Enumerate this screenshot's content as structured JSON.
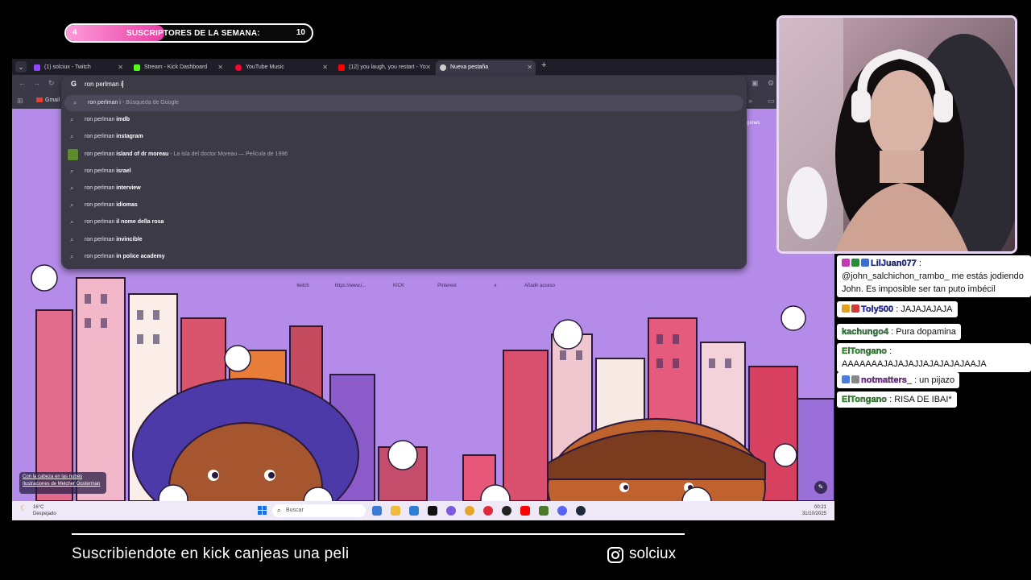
{
  "sub_goal": {
    "current": "4",
    "label": "SUSCRIPTORES DE LA SEMANA:",
    "goal": "10",
    "progress_fraction": 0.4,
    "fill_color": "#ff5fc4"
  },
  "browser": {
    "tabs": [
      {
        "label": "(1) solciux - Twitch",
        "icon": "twitch-icon",
        "color": "#9146ff"
      },
      {
        "label": "Stream - Kick Dashboard",
        "icon": "kick-icon",
        "color": "#53fc18"
      },
      {
        "label": "YouTube Music",
        "icon": "youtube-music-icon",
        "color": "#ff0033"
      },
      {
        "label": "(12) you laugh, you restart - Yo",
        "icon": "youtube-icon",
        "color": "#ff0000"
      },
      {
        "label": "Nueva pestaña",
        "icon": "chrome-icon",
        "color": "#cccccc"
      }
    ],
    "new_tab": "+",
    "bookmark_gmail": "Gmail",
    "omnibox": {
      "query": "ron perlman i",
      "suggestions": [
        {
          "prefix": "ron perlman i",
          "bold": "",
          "desc": " - Búsqueda de Google",
          "selected": true
        },
        {
          "prefix": "ron perlman ",
          "bold": "imdb",
          "desc": ""
        },
        {
          "prefix": "ron perlman ",
          "bold": "instagram",
          "desc": ""
        },
        {
          "prefix": "ron perlman ",
          "bold": "island of dr moreau",
          "desc": " - La isla del doctor Moreau — Película de 1996",
          "thumb": true
        },
        {
          "prefix": "ron perlman ",
          "bold": "israel",
          "desc": ""
        },
        {
          "prefix": "ron perlman ",
          "bold": "interview",
          "desc": ""
        },
        {
          "prefix": "ron perlman ",
          "bold": "idiomas",
          "desc": ""
        },
        {
          "prefix": "ron perlman ",
          "bold": "il nome della rosa",
          "desc": ""
        },
        {
          "prefix": "ron perlman ",
          "bold": "invincible",
          "desc": ""
        },
        {
          "prefix": "ron perlman ",
          "bold": "in police academy",
          "desc": ""
        }
      ]
    },
    "shortcuts": [
      "twitch",
      "https://www.i...",
      "KICK",
      "Pinterest",
      "x",
      "Añadir acceso"
    ],
    "side_label": "genes",
    "credit": {
      "line1": "Con la cabeza en las nubes",
      "line2": "Ilustraciones de Melcher Oosterman"
    }
  },
  "taskbar": {
    "temp": "16°C",
    "weather": "Despejado",
    "search_placeholder": "Buscar",
    "time": "00:21",
    "date": "31/10/2025"
  },
  "chat": [
    {
      "user": "LilJuan077",
      "text": ": @john_salchichon_rambo_ me estás jodiendo John. Es imposible ser tan puto imbécil",
      "color": "#1e2ca8",
      "badges": [
        "#c03ab4",
        "#2a8c3a",
        "#3a6fd1"
      ]
    },
    {
      "user": "Toly500",
      "text": ": JAJAJAJAJA",
      "color": "#2a2fc6",
      "badges": [
        "#e0a020",
        "#d23a3a"
      ]
    },
    {
      "user": "kachungo4",
      "text": ": Pura dopamina",
      "color": "#2e8b3a",
      "badges": []
    },
    {
      "user": "ElTongano",
      "text": ": AAAAAAAJAJAJAJJAJAJAJAJAAJA",
      "color": "#2e9a2e",
      "badges": []
    },
    {
      "user": "notmatters_",
      "text": ": un pijazo",
      "color": "#8e2bb0",
      "badges": [
        "#4a7be0",
        "#888888"
      ]
    },
    {
      "user": "ElTongano",
      "text": ": RISA DE IBAI*",
      "color": "#2e9a2e",
      "badges": []
    }
  ],
  "footer": {
    "text": "Suscribiendote en kick canjeas una peli",
    "instagram_handle": "solciux"
  }
}
